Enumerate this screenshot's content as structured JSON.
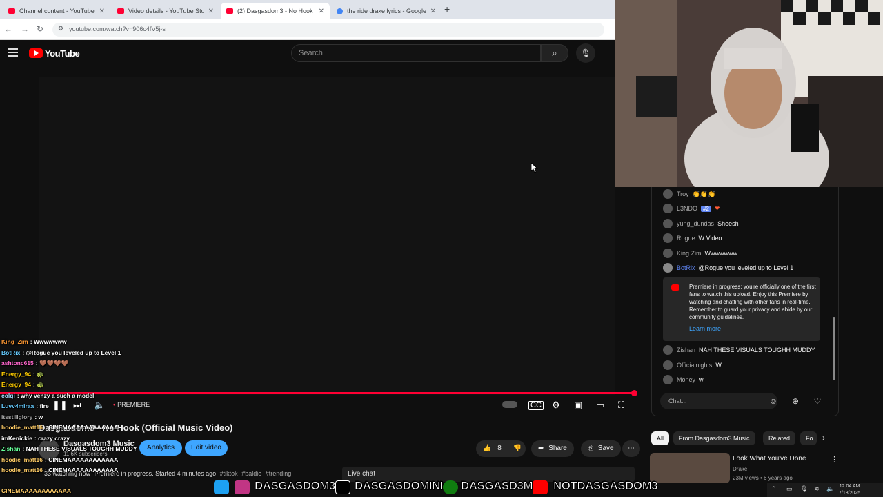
{
  "browser": {
    "tabs": [
      {
        "title": "Channel content - YouTube Stu",
        "color": "#ff0033"
      },
      {
        "title": "Video details - YouTube Studio",
        "color": "#ff0033"
      },
      {
        "title": "(2) Dasgasdom3 - No Hook",
        "color": "#ff0033"
      },
      {
        "title": "the ride drake lyrics - Google S",
        "color": "#4285f4"
      }
    ],
    "new_tab": "+",
    "url": "youtube.com/watch?v=906c4fV5j-s"
  },
  "masthead": {
    "logo_text": "YouTube",
    "search_placeholder": "Search"
  },
  "player": {
    "mode_label": "PREMIERE",
    "progress_percent": 100
  },
  "video": {
    "title": "Dasgasdom3 - No Hook (Official Music Video)",
    "channel": "Dasgasdom3 Music",
    "subscribers": "11.6K subscribers",
    "analytics_label": "Analytics",
    "edit_label": "Edit video",
    "likes": "8",
    "share_label": "Share",
    "save_label": "Save",
    "watching": "33 watching now",
    "status": "Premiere in progress. Started 4 minutes ago",
    "tags": [
      "#tiktok",
      "#baldie",
      "#trending"
    ],
    "live_chat_label": "Live chat"
  },
  "live_chat": {
    "messages": [
      {
        "user": "Troy",
        "text": "👏👏👏",
        "mod": false
      },
      {
        "user": "L3NDO",
        "badge": "#2",
        "text": "❤",
        "mod": false
      },
      {
        "user": "yung_dundas",
        "text": "Sheesh",
        "mod": false
      },
      {
        "user": "Rogue",
        "text": "W Video",
        "mod": false
      },
      {
        "user": "King Zim",
        "text": "Wwwwwww",
        "mod": false
      },
      {
        "user": "BotRix",
        "text": "@Rogue you leveled up to Level 1",
        "mod": true
      }
    ],
    "premiere_notice": "Premiere in progress: you're officially one of the first fans to watch this upload. Enjoy this Premiere by watching and chatting with other fans in real-time. Remember to guard your privacy and abide by our community guidelines.",
    "learn_more": "Learn more",
    "messages_after": [
      {
        "user": "Zishan",
        "text": "NAH THESE VISUALS TOUGHH MUDDY"
      },
      {
        "user": "Officialnights",
        "text": "W"
      },
      {
        "user": "Money",
        "text": "w"
      }
    ],
    "input_placeholder": "Chat..."
  },
  "related": {
    "chips": [
      "All",
      "From Dasgasdom3 Music",
      "Related",
      "Fo"
    ],
    "item": {
      "title": "Look What You've Done",
      "channel": "Drake",
      "meta": "23M views • 6 years ago"
    }
  },
  "stream_overlay": {
    "lines": [
      {
        "user": "King_Zim",
        "text": "Wwwwwww",
        "color": "#ff9933"
      },
      {
        "user": "BotRix",
        "text": "@Rogue you leveled up to Level 1",
        "color": "#66ccff"
      },
      {
        "user": "ashtonc615",
        "text": "🤎🤎🤎🤎",
        "color": "#ff66cc"
      },
      {
        "user": "Energy_94",
        "text": "🐢",
        "color": "#ffcc00"
      },
      {
        "user": "Energy_94",
        "text": "🐢",
        "color": "#ffcc00"
      },
      {
        "user": "colqi",
        "text": "why venzy a such a model",
        "color": "#aaddff"
      },
      {
        "user": "Luvv4miraa",
        "text": "fire",
        "color": "#66ccff"
      },
      {
        "user": "itsstillglory",
        "text": "w",
        "color": "#aaaaaa"
      },
      {
        "user": "hoodie_matt16",
        "text": "CINEMAAAAAAAAAAAA",
        "color": "#ffcc66"
      },
      {
        "user": "imKenickie",
        "text": "crazy crazy",
        "color": "#ffffff"
      },
      {
        "user": "Zishan",
        "text": "NAH THESE VISUALS TOUGHH MUDDY",
        "color": "#66ff99"
      },
      {
        "user": "hoodie_matt16",
        "text": "CINEMAAAAAAAAAAAA",
        "color": "#ffcc66"
      },
      {
        "user": "hoodie_matt16",
        "text": "CINEMAAAAAAAAAAAA",
        "color": "#ffcc66"
      },
      {
        "user": "",
        "text": "CINEMAAAAAAAAAAAA",
        "color": "#ffcc66"
      }
    ]
  },
  "socials": {
    "twitter": "DASGASDOM3",
    "tiktok": "DASGASDOMINI",
    "xbox": "DASGASD3M",
    "youtube": "NOTDASGASDOM3"
  },
  "taskbar": {
    "time": "12:04 AM",
    "date": "7/18/2025"
  }
}
